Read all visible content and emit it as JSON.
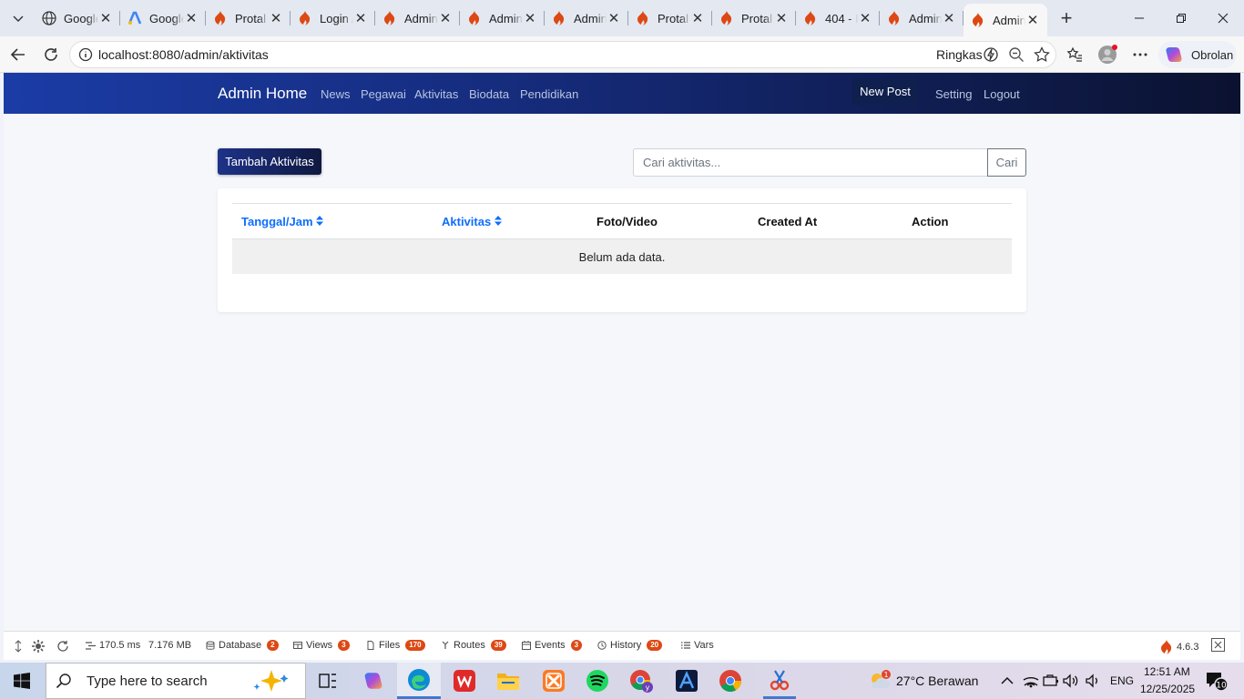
{
  "browser": {
    "tabs": [
      {
        "label": "Google",
        "icon": "globe-icon",
        "icon_color": "#333333"
      },
      {
        "label": "Google",
        "icon": "google-ads-icon",
        "icon_color": "#4285f4"
      },
      {
        "label": "Protal",
        "icon": "codeigniter-flame-icon",
        "icon_color": "#dd4814"
      },
      {
        "label": "Login A",
        "icon": "codeigniter-flame-icon",
        "icon_color": "#dd4814"
      },
      {
        "label": "Admin",
        "icon": "codeigniter-flame-icon",
        "icon_color": "#dd4814"
      },
      {
        "label": "Admin",
        "icon": "codeigniter-flame-icon",
        "icon_color": "#dd4814"
      },
      {
        "label": "Admin",
        "icon": "codeigniter-flame-icon",
        "icon_color": "#dd4814"
      },
      {
        "label": "Protal",
        "icon": "codeigniter-flame-icon",
        "icon_color": "#dd4814"
      },
      {
        "label": "Protal",
        "icon": "codeigniter-flame-icon",
        "icon_color": "#dd4814"
      },
      {
        "label": "404 - F",
        "icon": "codeigniter-flame-icon",
        "icon_color": "#dd4814"
      },
      {
        "label": "Admin",
        "icon": "codeigniter-flame-icon",
        "icon_color": "#dd4814"
      },
      {
        "label": "Admin",
        "icon": "codeigniter-flame-icon",
        "icon_color": "#dd4814",
        "active": true
      }
    ],
    "url": "localhost:8080/admin/aktivitas",
    "ringkas_label": "Ringkas",
    "copilot_label": "Obrolan"
  },
  "site": {
    "brand": "Admin Home",
    "nav_links": [
      "News",
      "Pegawai",
      "Aktivitas",
      "Biodata",
      "Pendidikan"
    ],
    "new_post_label": "New Post",
    "setting_label": "Setting",
    "logout_label": "Logout"
  },
  "page": {
    "add_button_label": "Tambah Aktivitas",
    "search_placeholder": "Cari aktivitas...",
    "search_button_label": "Cari",
    "table": {
      "columns": [
        "Tanggal/Jam",
        "Aktivitas",
        "Foto/Video",
        "Created At",
        "Action"
      ],
      "sortable": [
        true,
        true,
        false,
        false,
        false
      ],
      "empty_message": "Belum ada data."
    }
  },
  "debug_toolbar": {
    "time": "170.5 ms",
    "memory": "7.176 MB",
    "items": [
      {
        "label": "Database",
        "count": "2"
      },
      {
        "label": "Views",
        "count": "3"
      },
      {
        "label": "Files",
        "count": "170"
      },
      {
        "label": "Routes",
        "count": "39"
      },
      {
        "label": "Events",
        "count": "3"
      },
      {
        "label": "History",
        "count": "20"
      },
      {
        "label": "Vars",
        "count": ""
      }
    ],
    "version": "4.6.3",
    "accent_color": "#dd4814"
  },
  "taskbar": {
    "search_placeholder": "Type here to search",
    "weather": "27°C  Berawan",
    "weather_badge": "1",
    "language": "ENG",
    "time": "12:51 AM",
    "date": "12/25/2025",
    "notification_count": "10"
  },
  "colors": {
    "navbar_start": "#1b3ca6",
    "navbar_end": "#0b1230",
    "link_blue": "#0d6efd",
    "ci_orange": "#dd4814"
  }
}
